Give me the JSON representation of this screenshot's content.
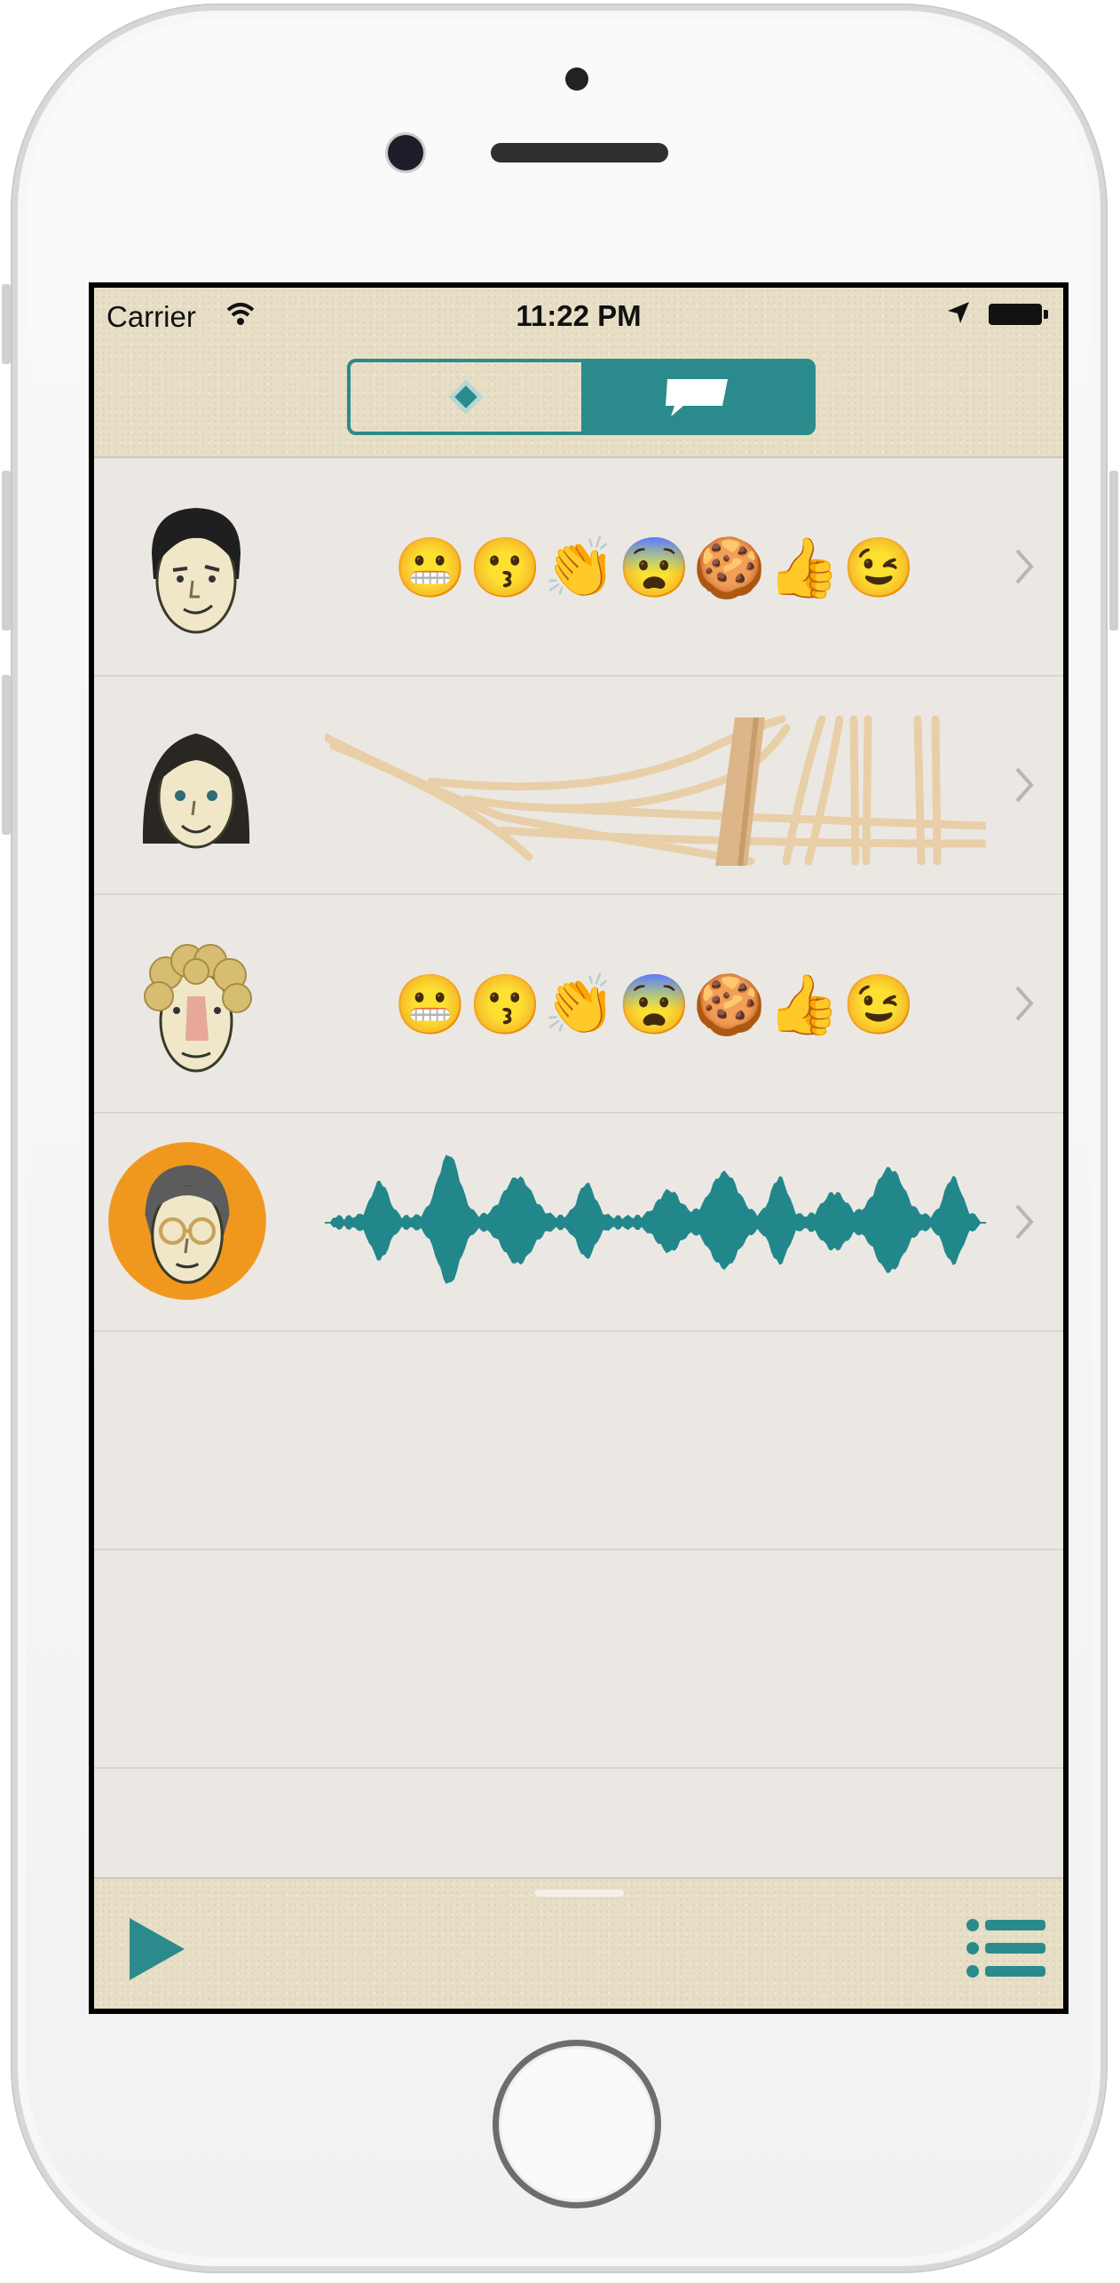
{
  "status_bar": {
    "carrier": "Carrier",
    "time": "11:22 PM",
    "wifi_icon": "wifi-icon",
    "location_icon": "location-arrow-icon",
    "battery_icon": "battery-full-icon"
  },
  "segmented_control": {
    "accent_color": "#2b8b8c",
    "segments": [
      {
        "icon": "diamond-icon",
        "selected": false
      },
      {
        "icon": "speech-bubble-icon",
        "selected": true
      }
    ]
  },
  "messages": [
    {
      "avatar": "man-dark-hair-avatar",
      "type": "emoji",
      "emojis": "😬😗👏😨🍪👍😉"
    },
    {
      "avatar": "woman-dark-hair-avatar",
      "type": "drawing",
      "drawing": "sketch-strokes"
    },
    {
      "avatar": "man-curly-blond-avatar",
      "type": "emoji",
      "emojis": "😬😗👏😨🍪👍😉"
    },
    {
      "avatar": "man-glasses-orange-avatar",
      "type": "audio",
      "waveform_color": "#22878a"
    }
  ],
  "toolbar": {
    "play_icon": "play-icon",
    "list_icon": "list-icon"
  }
}
